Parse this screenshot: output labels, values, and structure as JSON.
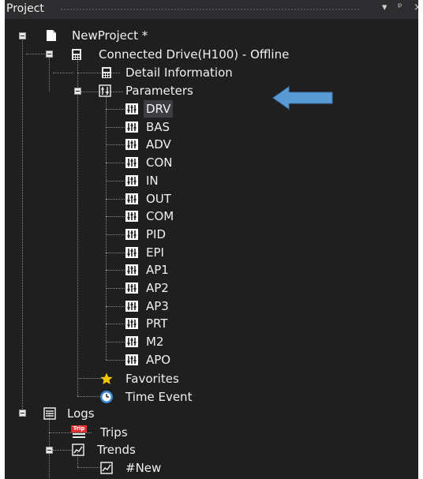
{
  "titlebar": {
    "title": "Project",
    "dropdown_glyph": "▾",
    "pin_glyph": "ᵖ",
    "close_glyph": "×"
  },
  "project": {
    "label": "NewProject *",
    "icon": "document-icon"
  },
  "drive": {
    "label": "Connected Drive(H100) - Offline",
    "icon": "drive-icon"
  },
  "detail": {
    "label": "Detail Information",
    "icon": "drive-detail-icon"
  },
  "parameters": {
    "label": "Parameters",
    "icon": "parameters-icon"
  },
  "param_groups": [
    "DRV",
    "BAS",
    "ADV",
    "CON",
    "IN",
    "OUT",
    "COM",
    "PID",
    "EPI",
    "AP1",
    "AP2",
    "AP3",
    "PRT",
    "M2",
    "APO"
  ],
  "selected_group": "DRV",
  "favorites": {
    "label": "Favorites",
    "icon": "star-icon"
  },
  "time_event": {
    "label": "Time Event",
    "icon": "clock-icon"
  },
  "logs": {
    "label": "Logs",
    "icon": "list-icon"
  },
  "trips": {
    "label": "Trips",
    "icon": "trip-icon",
    "badge": "Trip"
  },
  "trends": {
    "label": "Trends",
    "icon": "trend-chart-icon"
  },
  "new_trend": {
    "label": "#New",
    "icon": "trend-chart-icon"
  },
  "colors": {
    "panel_bg": "#1f1f1f",
    "text": "#f1f1f1",
    "arrow": "#5b9bd5",
    "star": "#f5c400",
    "clock": "#3a86d8",
    "trip": "#e03030"
  }
}
